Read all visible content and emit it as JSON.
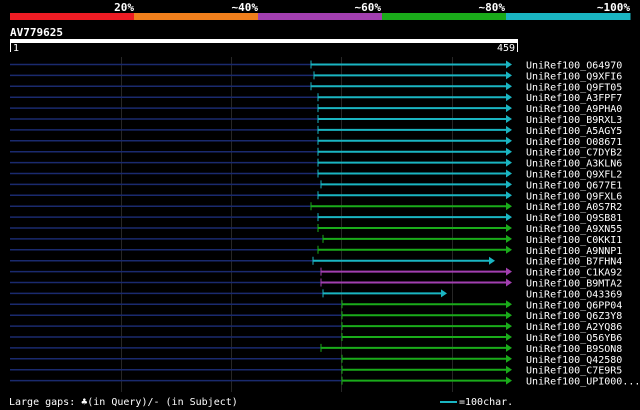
{
  "scale": {
    "labels": [
      "20%",
      "~40%",
      "~60%",
      "~80%",
      "~100%"
    ],
    "colors": [
      "#ee1c24",
      "#f07f1c",
      "#a23fb0",
      "#1aab1a",
      "#1ab5c2"
    ]
  },
  "query": {
    "name": "AV779625",
    "start_label": "1",
    "end_label": "459"
  },
  "hits": [
    {
      "name": "UniRef100_O64970",
      "color": "#1ab5c2"
    },
    {
      "name": "UniRef100_Q9XFI6",
      "color": "#1ab5c2"
    },
    {
      "name": "UniRef100_Q9FT05",
      "color": "#1ab5c2"
    },
    {
      "name": "UniRef100_A3FPF7",
      "color": "#1ab5c2"
    },
    {
      "name": "UniRef100_A9PHA0",
      "color": "#1ab5c2"
    },
    {
      "name": "UniRef100_B9RXL3",
      "color": "#1ab5c2"
    },
    {
      "name": "UniRef100_A5AGY5",
      "color": "#1ab5c2"
    },
    {
      "name": "UniRef100_O08671",
      "color": "#1ab5c2"
    },
    {
      "name": "UniRef100_C7DYB2",
      "color": "#1ab5c2"
    },
    {
      "name": "UniRef100_A3KLN6",
      "color": "#1ab5c2"
    },
    {
      "name": "UniRef100_Q9XFL2",
      "color": "#1ab5c2"
    },
    {
      "name": "UniRef100_Q677E1",
      "color": "#1ab5c2"
    },
    {
      "name": "UniRef100_Q9FXL6",
      "color": "#1ab5c2"
    },
    {
      "name": "UniRef100_A0S7R2",
      "color": "#1aab1a"
    },
    {
      "name": "UniRef100_Q9SB81",
      "color": "#1ab5c2"
    },
    {
      "name": "UniRef100_A9XN55",
      "color": "#1aab1a"
    },
    {
      "name": "UniRef100_C0KKI1",
      "color": "#1aab1a"
    },
    {
      "name": "UniRef100_A9NNP1",
      "color": "#1aab1a"
    },
    {
      "name": "UniRef100_B7FHN4",
      "color": "#1ab5c2"
    },
    {
      "name": "UniRef100_C1KA92",
      "color": "#a23fb0"
    },
    {
      "name": "UniRef100_B9MTA2",
      "color": "#a23fb0"
    },
    {
      "name": "UniRef100_O43369",
      "color": "#1ab5c2"
    },
    {
      "name": "UniRef100_Q6PP04",
      "color": "#1aab1a"
    },
    {
      "name": "UniRef100_Q6Z3Y8",
      "color": "#1aab1a"
    },
    {
      "name": "UniRef100_A2YQ86",
      "color": "#1aab1a"
    },
    {
      "name": "UniRef100_Q56YB6",
      "color": "#1aab1a"
    },
    {
      "name": "UniRef100_B9SON8",
      "color": "#1aab1a"
    },
    {
      "name": "UniRef100_Q42580",
      "color": "#1aab1a"
    },
    {
      "name": "UniRef100_C7E9R5",
      "color": "#1aab1a"
    },
    {
      "name": "UniRef100_UPI000...",
      "color": "#1aab1a"
    }
  ],
  "legend": {
    "gaps_text": "Large gaps: ♣(in Query)/- (in Subject)",
    "scale_text": "=100char."
  }
}
